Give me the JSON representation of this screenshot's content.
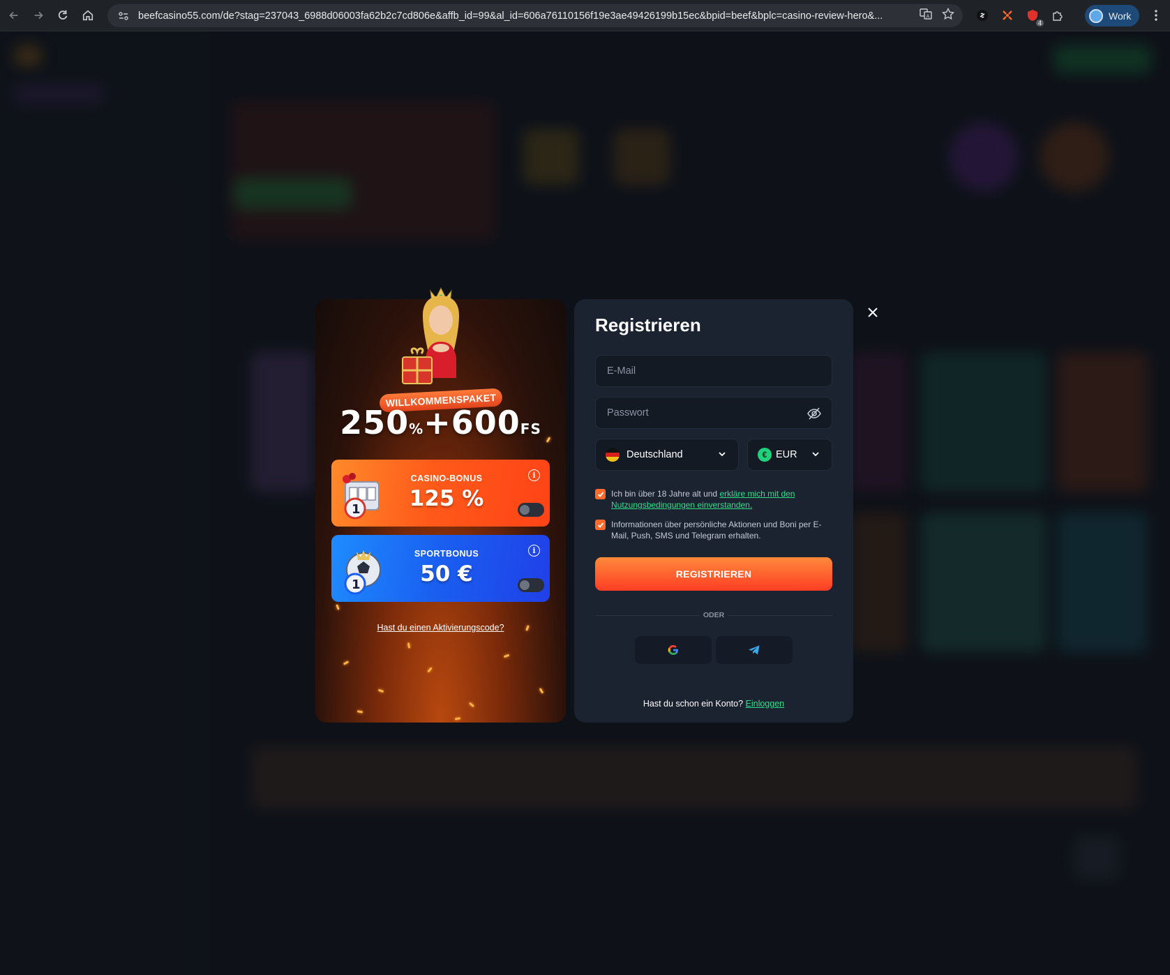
{
  "browser": {
    "url": "beefcasino55.com/de?stag=237043_6988d06003fa62b2c7cd806e&affb_id=99&al_id=606a76110156f19e3ae49426199b15ec&bpid=beef&bplc=casino-review-hero&...",
    "profile_label": "Work",
    "extension_badge": "4"
  },
  "promo": {
    "welcome_tag": "WILLKOMMENSPAKET",
    "headline_main": "250",
    "headline_pct": "%",
    "headline_plus": "+600",
    "headline_fs": "FS",
    "casino_bonus_title": "CASINO-BONUS",
    "casino_bonus_value": "125 %",
    "sport_bonus_title": "SPORTBONUS",
    "sport_bonus_value": "50 €",
    "activation_code_link": "Hast du einen Aktivierungscode?"
  },
  "register": {
    "title": "Registrieren",
    "email_placeholder": "E-Mail",
    "password_placeholder": "Passwort",
    "country": "Deutschland",
    "currency": "EUR",
    "currency_symbol": "€",
    "terms_text": "Ich bin über 18 Jahre alt und ",
    "terms_link": "erkläre mich mit den Nutzungsbedingungen einverstanden.",
    "marketing_text": "Informationen über persönliche Aktionen und Boni per E-Mail, Push, SMS und Telegram erhalten.",
    "terms_checked": true,
    "marketing_checked": true,
    "submit_label": "REGISTRIEREN",
    "divider_label": "ODER",
    "login_prompt": "Hast du schon ein Konto? ",
    "login_link": "Einloggen"
  },
  "colors": {
    "accent_orange": "#ff5a1a",
    "accent_green": "#2fe08a",
    "modal_bg": "#1b2230",
    "sport_blue": "#1a5ef0"
  }
}
